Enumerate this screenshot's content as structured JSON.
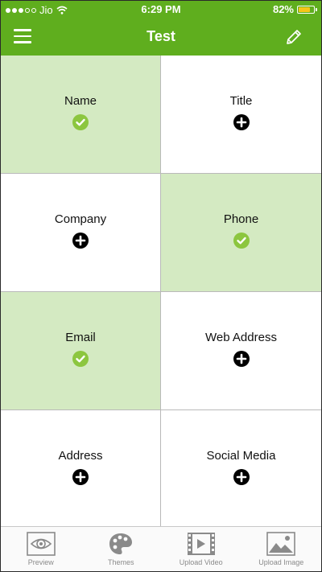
{
  "status": {
    "carrier": "Jio",
    "time": "6:29 PM",
    "battery": "82%",
    "battery_level": 0.82,
    "signal_bars": 3
  },
  "nav": {
    "title": "Test",
    "menu_icon": "hamburger-icon",
    "edit_icon": "pencil-icon"
  },
  "colors": {
    "brand": "#5fae1e",
    "done_cell": "#d4eac2",
    "check": "#8cc63f"
  },
  "fields": [
    {
      "label": "Name",
      "state": "done",
      "icon": "check-circle-icon"
    },
    {
      "label": "Title",
      "state": "add",
      "icon": "plus-circle-icon"
    },
    {
      "label": "Company",
      "state": "add",
      "icon": "plus-circle-icon"
    },
    {
      "label": "Phone",
      "state": "done",
      "icon": "check-circle-icon"
    },
    {
      "label": "Email",
      "state": "done",
      "icon": "check-circle-icon"
    },
    {
      "label": "Web Address",
      "state": "add",
      "icon": "plus-circle-icon"
    },
    {
      "label": "Address",
      "state": "add",
      "icon": "plus-circle-icon"
    },
    {
      "label": "Social Media",
      "state": "add",
      "icon": "plus-circle-icon"
    }
  ],
  "tabs": [
    {
      "label": "Preview",
      "icon": "eye-icon"
    },
    {
      "label": "Themes",
      "icon": "palette-icon"
    },
    {
      "label": "Upload Video",
      "icon": "film-icon"
    },
    {
      "label": "Upload Image",
      "icon": "image-icon"
    }
  ]
}
